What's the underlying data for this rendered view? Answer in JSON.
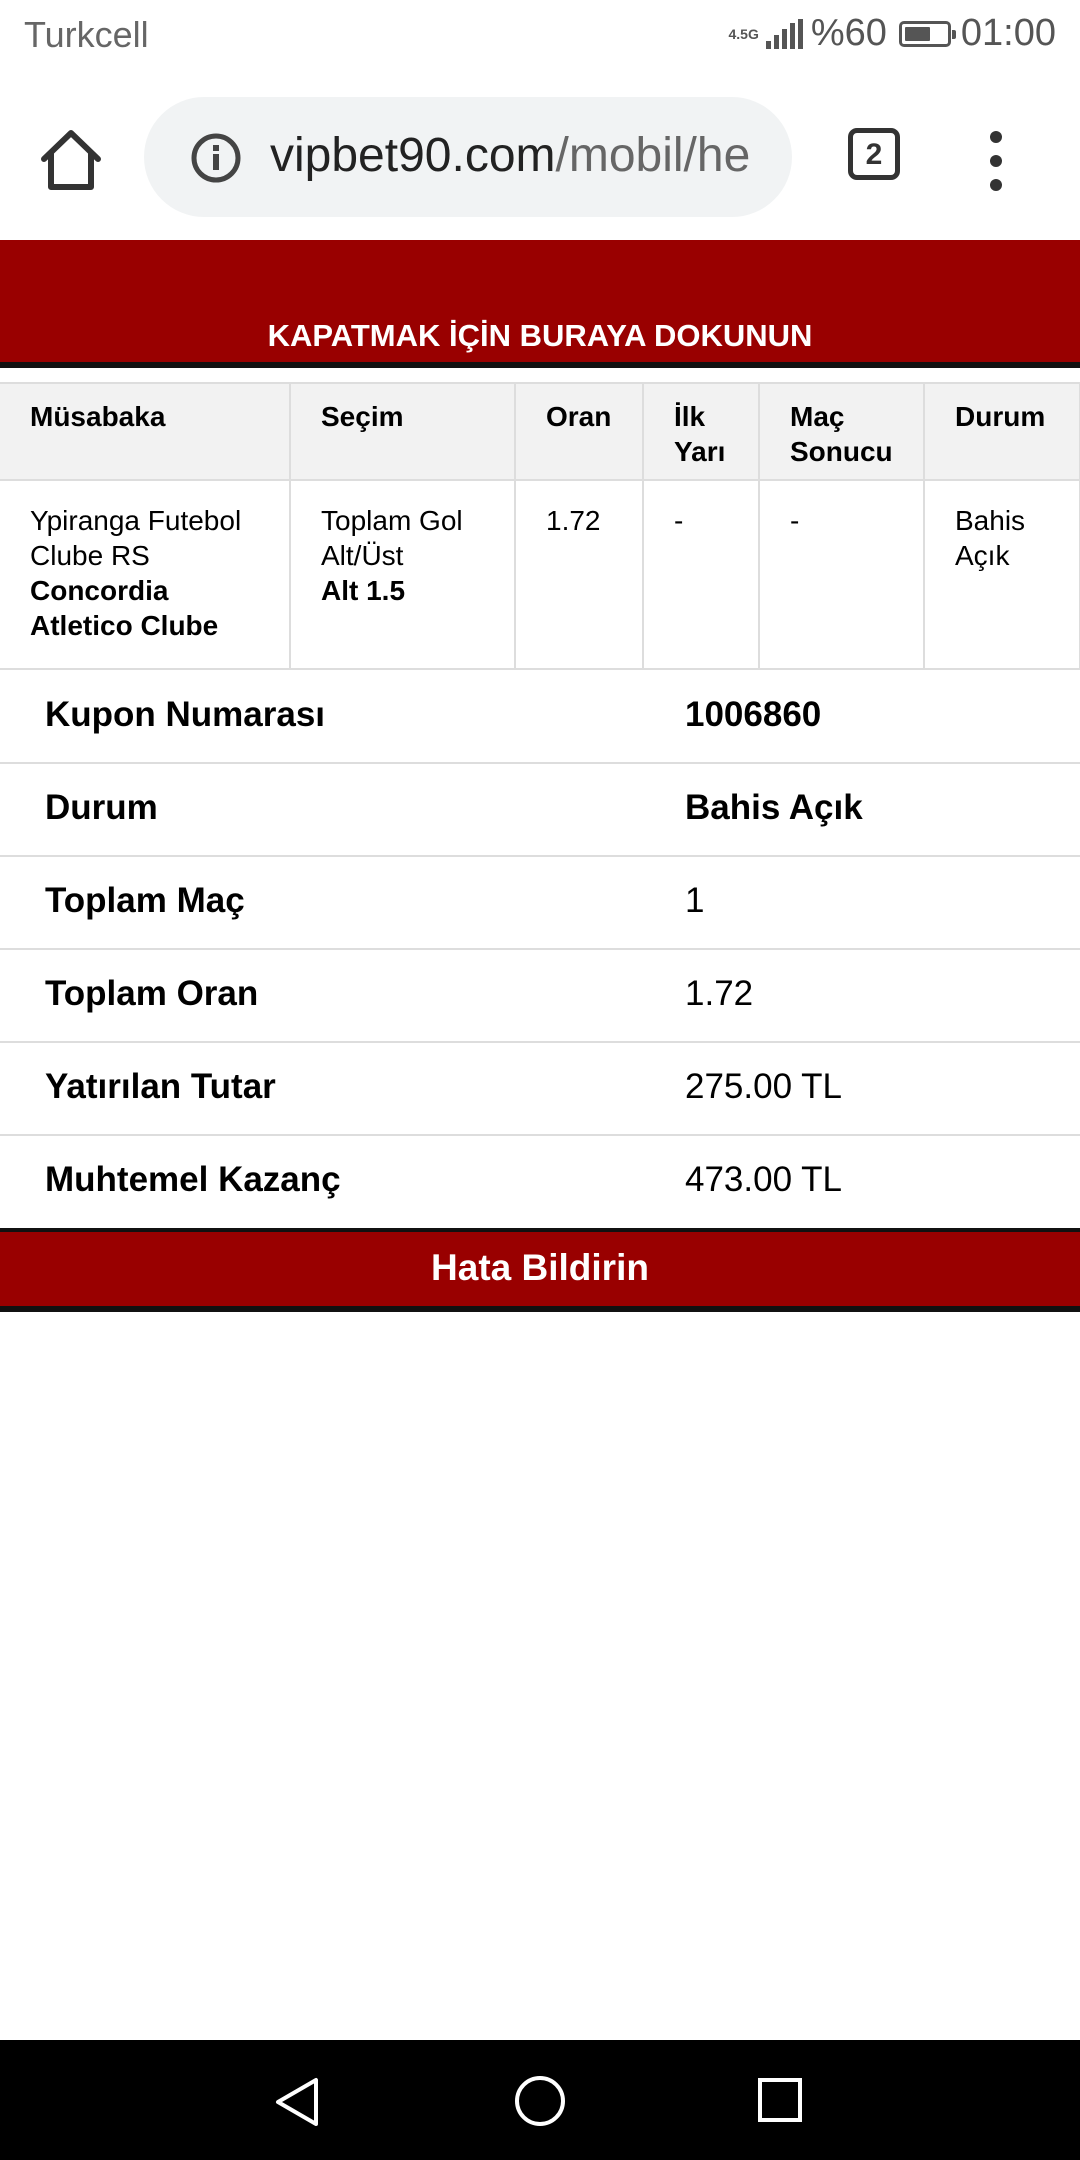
{
  "status_bar": {
    "carrier": "Turkcell",
    "network": "4.5G",
    "battery": "%60",
    "time": "01:00"
  },
  "browser": {
    "url_domain": "vipbet90.com",
    "url_path": "/mobil/he",
    "tab_count": "2"
  },
  "banner": {
    "label": "KAPATMAK İÇİN BURAYA DOKUNUN"
  },
  "bet_table": {
    "headers": [
      "Müsabaka",
      "Seçim",
      "Oran",
      "İlk Yarı",
      "Maç Sonucu",
      "Durum"
    ],
    "row": {
      "home_team": "Ypiranga Futebol Clube RS",
      "away_team": "Concordia Atletico Clube",
      "market": "Toplam Gol Alt/Üst",
      "selection": "Alt 1.5",
      "odds": "1.72",
      "first_half": "-",
      "full_time": "-",
      "status": "Bahis Açık"
    }
  },
  "summary": {
    "coupon_number_label": "Kupon Numarası",
    "coupon_number": "1006860",
    "status_label": "Durum",
    "status": "Bahis Açık",
    "total_matches_label": "Toplam Maç",
    "total_matches": "1",
    "total_odds_label": "Toplam Oran",
    "total_odds": "1.72",
    "stake_label": "Yatırılan Tutar",
    "stake": "275.00 TL",
    "potential_win_label": "Muhtemel Kazanç",
    "potential_win": "473.00 TL"
  },
  "report_button": {
    "label": "Hata Bildirin"
  },
  "colors": {
    "accent": "#990000",
    "header_bg": "#f2f2f2",
    "border": "#dddddd"
  }
}
